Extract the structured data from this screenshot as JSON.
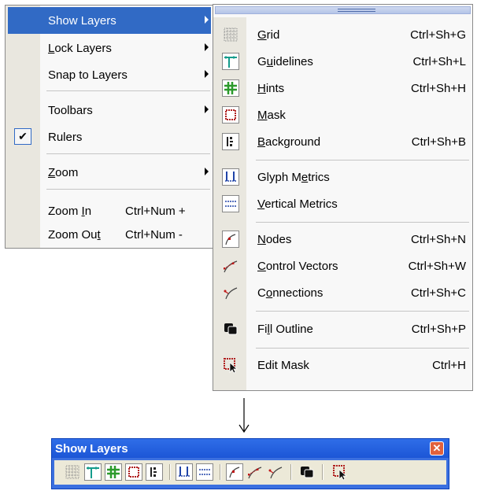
{
  "view_menu": {
    "items": [
      {
        "label": "Show Layers",
        "has_submenu": true,
        "selected": true
      },
      {
        "label_pre": "",
        "label_u": "L",
        "label_post": "ock Layers",
        "has_submenu": true
      },
      {
        "label": "Snap to Layers",
        "has_submenu": true
      },
      {
        "label": "Toolbars",
        "has_submenu": true
      },
      {
        "label": "Rulers",
        "checked": true,
        "check_glyph": "✔"
      },
      {
        "label_pre": "",
        "label_u": "Z",
        "label_post": "oom",
        "has_submenu": true
      },
      {
        "label_pre": "Zoom ",
        "label_u": "I",
        "label_post": "n",
        "shortcut": "Ctrl+Num +"
      },
      {
        "label_pre": "Zoom Ou",
        "label_u": "t",
        "label_post": "",
        "shortcut": "Ctrl+Num -"
      }
    ]
  },
  "show_layers_submenu": {
    "items": [
      {
        "icon": "grid-icon",
        "label_pre": "",
        "label_u": "G",
        "label_post": "rid",
        "shortcut": "Ctrl+Sh+G"
      },
      {
        "icon": "guidelines-icon",
        "label_pre": "G",
        "label_u": "u",
        "label_post": "idelines",
        "shortcut": "Ctrl+Sh+L"
      },
      {
        "icon": "hints-icon",
        "label_pre": "",
        "label_u": "H",
        "label_post": "ints",
        "shortcut": "Ctrl+Sh+H"
      },
      {
        "icon": "mask-icon",
        "label_pre": "",
        "label_u": "M",
        "label_post": "ask",
        "shortcut": ""
      },
      {
        "icon": "background-icon",
        "label_pre": "",
        "label_u": "B",
        "label_post": "ackground",
        "shortcut": "Ctrl+Sh+B"
      },
      {
        "icon": "glyph-metrics-icon",
        "label_pre": "Glyph M",
        "label_u": "e",
        "label_post": "trics",
        "shortcut": ""
      },
      {
        "icon": "vertical-metrics-icon",
        "label_pre": "",
        "label_u": "V",
        "label_post": "ertical Metrics",
        "shortcut": ""
      },
      {
        "icon": "nodes-icon",
        "label_pre": "",
        "label_u": "N",
        "label_post": "odes",
        "shortcut": "Ctrl+Sh+N"
      },
      {
        "icon": "control-vectors-icon",
        "label_pre": "",
        "label_u": "C",
        "label_post": "ontrol Vectors",
        "shortcut": "Ctrl+Sh+W"
      },
      {
        "icon": "connections-icon",
        "label_pre": "C",
        "label_u": "o",
        "label_post": "nnections",
        "shortcut": "Ctrl+Sh+C"
      },
      {
        "icon": "fill-outline-icon",
        "label_pre": "Fi",
        "label_u": "l",
        "label_post": "l Outline",
        "shortcut": "Ctrl+Sh+P"
      },
      {
        "icon": "edit-mask-icon",
        "label_pre": "",
        "label_u": "",
        "label_post": "Edit Mask",
        "shortcut": "Ctrl+H"
      }
    ]
  },
  "arrow_glyph": "↓",
  "toolbar": {
    "title": "Show Layers",
    "close_glyph": "✕",
    "buttons": [
      "grid-icon",
      "guidelines-icon",
      "hints-icon",
      "mask-icon",
      "background-icon",
      "glyph-metrics-icon",
      "vertical-metrics-icon",
      "nodes-icon",
      "control-vectors-icon",
      "connections-icon",
      "fill-outline-icon",
      "edit-mask-icon"
    ]
  },
  "colors": {
    "highlight": "#316ac5",
    "menu_background": "#f8f8f8",
    "gutter": "#e9e7df",
    "title_bar": "#1c56d6",
    "close_button": "#e2613c",
    "toolbar_body": "#ece9d8"
  }
}
